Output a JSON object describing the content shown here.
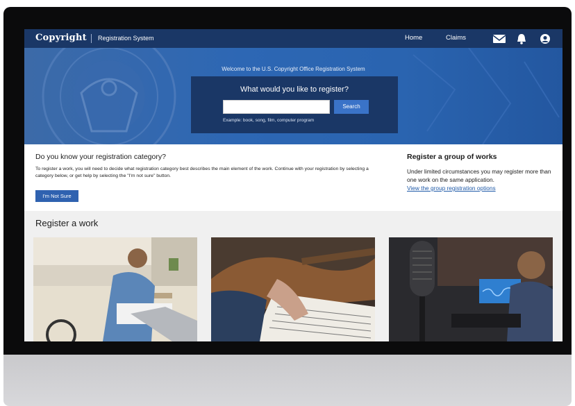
{
  "nav": {
    "logo": "Copyright",
    "system": "Registration System",
    "home": "Home",
    "claims": "Claims",
    "icons": [
      "mail-icon",
      "bell-icon",
      "user-icon"
    ]
  },
  "hero": {
    "welcome": "Welcome to the U.S. Copyright Office Registration System",
    "question": "What would you like to register?",
    "search_value": "",
    "search_button": "Search",
    "example": "Example: book, song, film, computer program"
  },
  "category": {
    "title": "Do you know your registration category?",
    "body": "To register a work, you will need to decide what registration category best describes the main element of the work. Continue with your registration by selecting a category below, or get help by selecting the \"I'm not sure\" button.",
    "button": "I'm Not Sure"
  },
  "group": {
    "title": "Register a group of works",
    "body": "Under limited circumstances you may register more than one work on the same application.",
    "link": "View the group registration options"
  },
  "register": {
    "title": "Register a work"
  },
  "colors": {
    "nav": "#1a3766",
    "hero": "#2d67b4",
    "accent": "#2f62b0",
    "link": "#1f5aa8"
  }
}
